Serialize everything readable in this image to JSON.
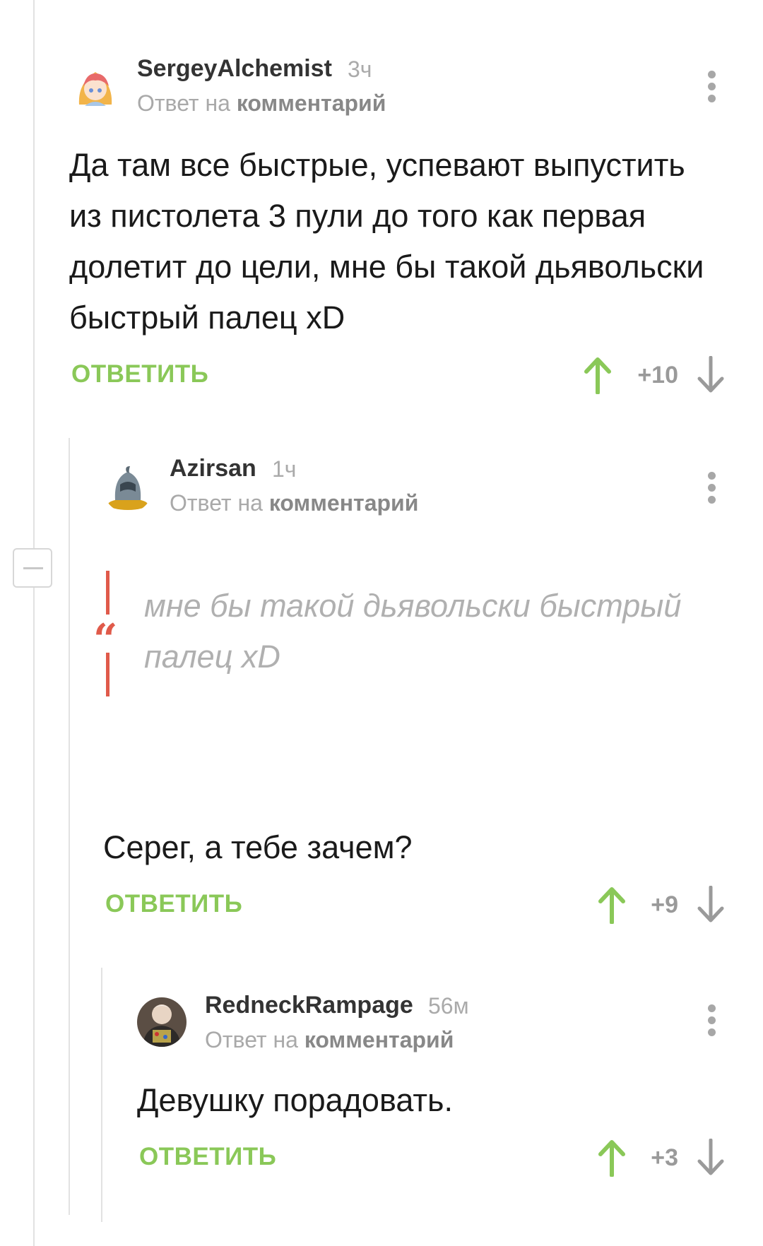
{
  "comments": [
    {
      "author": "SergeyAlchemist",
      "time": "3ч",
      "reply_prefix": "Ответ на",
      "reply_target": "комментарий",
      "text": "Да там все быстрые, успевают выпустить из пистолета 3 пули до того как первая долетит до цели, мне бы такой дьявольски быстрый палец xD",
      "reply_label": "ОТВЕТИТЬ",
      "score": "+10"
    },
    {
      "author": "Azirsan",
      "time": "1ч",
      "reply_prefix": "Ответ на",
      "reply_target": "комментарий",
      "quote": "мне бы такой дьявольски быстрый палец xD",
      "text": "Серег, а тебе зачем?",
      "reply_label": "ОТВЕТИТЬ",
      "score": "+9"
    },
    {
      "author": "RedneckRampage",
      "time": "56м",
      "reply_prefix": "Ответ на",
      "reply_target": "комментарий",
      "text": "Девушку порадовать.",
      "reply_label": "ОТВЕТИТЬ",
      "score": "+3"
    }
  ],
  "colors": {
    "accent_green": "#8ac858",
    "quote_red": "#e05a4a",
    "muted": "#a9a9a9"
  },
  "icons": [
    "more-vertical-icon",
    "upvote-arrow-icon",
    "downvote-arrow-icon",
    "collapse-minus-icon",
    "quote-icon"
  ]
}
